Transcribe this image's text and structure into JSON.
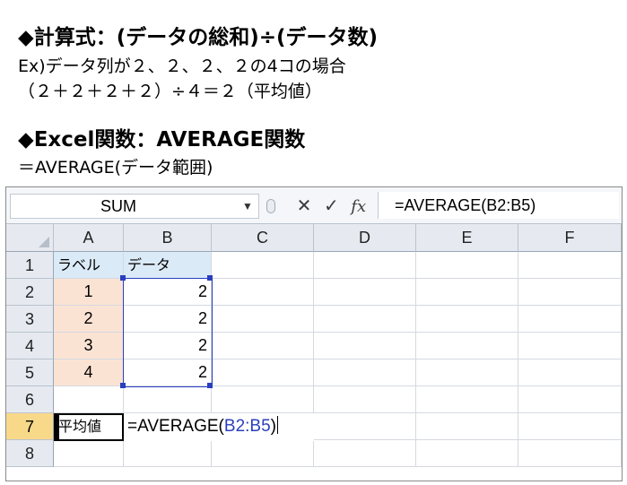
{
  "heading1": "◆計算式：(データの総和)÷(データ数)",
  "example_line1": "Ex)データ列が２、２、２、２の4コの場合",
  "example_line2": "（２＋２＋２＋２）÷４＝２（平均値）",
  "heading2": "◆Excel関数：AVERAGE関数",
  "syntax_line": "＝AVERAGE(データ範囲)",
  "excel": {
    "name_box": "SUM",
    "icons": [
      "cancel-x-icon",
      "enter-check-icon",
      "insert-function-icon"
    ],
    "icon_glyphs": {
      "cancel": "✕",
      "enter": "✓",
      "fx": "fx"
    },
    "formula_bar": "=AVERAGE(B2:B5)",
    "columns": [
      "A",
      "B",
      "C",
      "D",
      "E",
      "F"
    ],
    "rows": [
      "1",
      "2",
      "3",
      "4",
      "5",
      "6",
      "7",
      "8"
    ],
    "cells": {
      "A1": "ラベル",
      "B1": "データ",
      "A2": "1",
      "B2": "2",
      "A3": "2",
      "B3": "2",
      "A4": "3",
      "B4": "2",
      "A5": "4",
      "B5": "2",
      "A7": "平均値",
      "B7_prefix": "=AVERAGE(",
      "B7_ref": "B2:B5",
      "B7_suffix": ")"
    },
    "colors": {
      "selected_header": "#f8d98a",
      "label_fill": "#fbe3d4",
      "header_fill": "#dbeaf7",
      "range_border": "#2a3fbf"
    }
  }
}
